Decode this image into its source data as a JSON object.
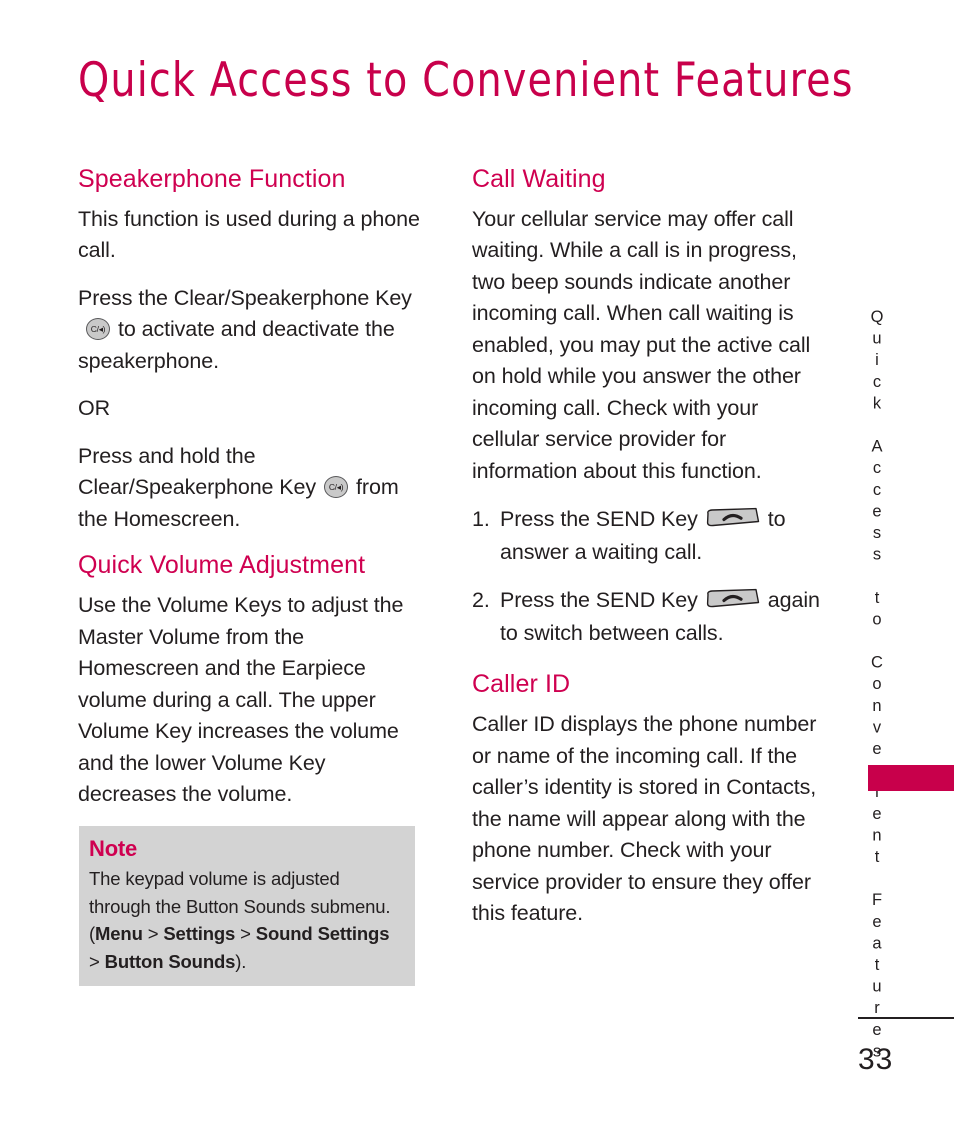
{
  "document": {
    "page_title": "Quick Access to Convenient Features",
    "page_number": "33",
    "side_tab_label": "Quick Access to Convenient Features"
  },
  "left_column": {
    "section_1": {
      "heading": "Speakerphone Function",
      "paragraph_1": "This function is used during a phone call.",
      "paragraph_2_before": "Press the Clear/Speakerphone Key",
      "paragraph_2_after": "to activate and deactivate the speakerphone.",
      "paragraph_3": "OR",
      "paragraph_4_before": "Press and hold the Clear/Speakerphone Key",
      "paragraph_4_after": "from the Homescreen."
    },
    "section_2": {
      "heading": "Quick Volume Adjustment",
      "paragraph_1": "Use the Volume Keys to adjust the Master Volume from the Homescreen and the Earpiece volume during a call. The upper Volume Key increases the volume and the lower Volume Key decreases the volume."
    },
    "note": {
      "title": "Note",
      "text_1": "The keypad volume is adjusted through the Button Sounds submenu. (",
      "bold_1": "Menu",
      "sep_1": " > ",
      "bold_2": "Settings",
      "sep_2": " > ",
      "bold_3": "Sound Settings",
      "sep_3": " > ",
      "bold_4": "Button Sounds",
      "text_2": ")."
    }
  },
  "right_column": {
    "section_1": {
      "heading": "Call Waiting",
      "paragraph_1": "Your cellular service may offer call waiting. While a call is in progress, two beep sounds indicate another incoming call. When call waiting is enabled, you may put the active call on hold while you answer the other incoming call. Check with your cellular service provider for information about this function.",
      "steps": [
        {
          "number": "1.",
          "text_before": "Press the SEND Key",
          "text_after": "to answer a waiting call."
        },
        {
          "number": "2.",
          "text_before": "Press the SEND Key",
          "text_after": "again to switch between calls."
        }
      ]
    },
    "section_2": {
      "heading": "Caller ID",
      "paragraph_1": "Caller ID displays the phone number or name of the incoming call. If the caller’s identity is stored in Contacts, the name will appear along with the phone number. Check with your service provider to ensure they offer this feature."
    }
  },
  "icons": {
    "clear_speakerphone_key_glyph": "C/◂)",
    "send_key_name": "send-key-icon"
  },
  "colors": {
    "accent_pink": "#c8004b",
    "heading_pink": "#cf0050",
    "note_background": "#d3d3d3",
    "body_text": "#231f20",
    "key_fill": "#c9c9c9",
    "key_stroke": "#58585a"
  }
}
